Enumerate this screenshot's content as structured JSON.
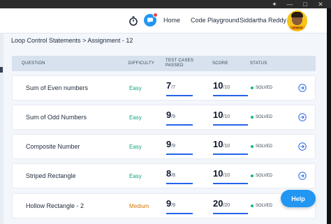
{
  "header": {
    "nav_home": "Home",
    "nav_playground": "Code Playground",
    "user_name": "Siddartha Reddy",
    "avatar_badge": "GENIUS"
  },
  "breadcrumb": {
    "section": "Loop Control Statements",
    "separator": ">",
    "assignment": "Assignment - 12"
  },
  "table": {
    "headers": {
      "question": "QUESTION",
      "difficulty": "DIFFICULTY",
      "tests": "TEST CASES PASSED",
      "score": "SCORE",
      "status": "STATUS"
    },
    "rows": [
      {
        "question": "Sum of Even numbers",
        "difficulty": "Easy",
        "passed": "7",
        "total": "/7",
        "score": "10",
        "max": "/10",
        "status": "SOLVED"
      },
      {
        "question": "Sum of Odd Numbers",
        "difficulty": "Easy",
        "passed": "9",
        "total": "/9",
        "score": "10",
        "max": "/10",
        "status": "SOLVED"
      },
      {
        "question": "Composite Number",
        "difficulty": "Easy",
        "passed": "9",
        "total": "/9",
        "score": "10",
        "max": "/10",
        "status": "SOLVED"
      },
      {
        "question": "Striped Rectangle",
        "difficulty": "Easy",
        "passed": "8",
        "total": "/8",
        "score": "10",
        "max": "/10",
        "status": "SOLVED"
      },
      {
        "question": "Hollow Rectangle - 2",
        "difficulty": "Medium",
        "passed": "9",
        "total": "/9",
        "score": "20",
        "max": "/20",
        "status": "SOLVED"
      }
    ]
  },
  "help_label": "Help",
  "colors": {
    "accent": "#2563eb",
    "easy": "#10a37f",
    "medium": "#d97706",
    "solved": "#10b981"
  }
}
